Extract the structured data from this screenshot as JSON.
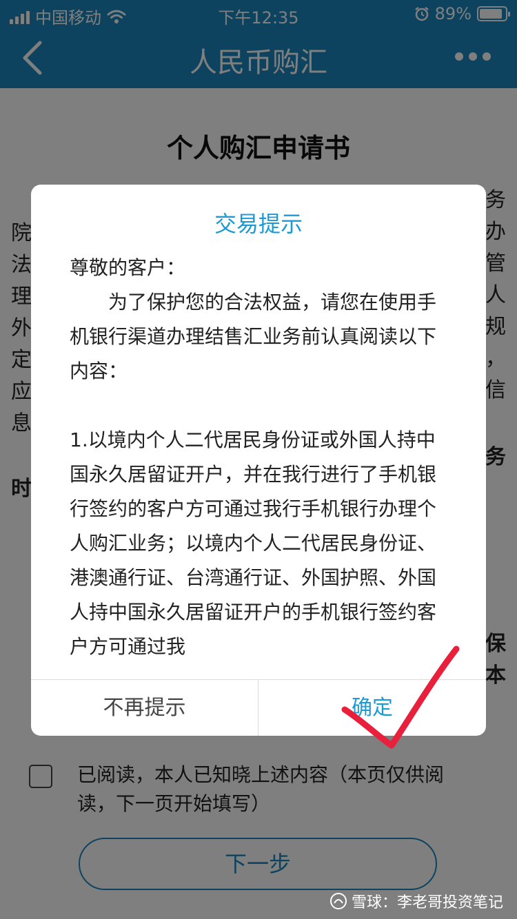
{
  "status_bar": {
    "carrier": "中国移动",
    "time": "下午12:35",
    "battery": "89%",
    "battery_level": 0.89
  },
  "nav": {
    "title": "人民币购汇",
    "back_icon": "chevron-left-icon",
    "more_icon": "more-dots-icon"
  },
  "page": {
    "doc_title": "个人购汇申请书",
    "left_edge": [
      "院",
      "法",
      "理",
      "外",
      "定",
      "应",
      "息"
    ],
    "right_edge": [
      "务",
      "办",
      "管",
      "人",
      "规",
      "，",
      "信"
    ],
    "bold_left": "时",
    "bold_right": "务",
    "bold_right_lower": [
      "保",
      "本"
    ],
    "read_confirm": "已阅读，本人已知晓上述内容（本页仅供阅读，下一页开始填写）",
    "next_button": "下一步"
  },
  "dialog": {
    "title": "交易提示",
    "greeting": "尊敬的客户：",
    "intro": "为了保护您的合法权益，请您在使用手机银行渠道办理结售汇业务前认真阅读以下内容：",
    "item1": "1.以境内个人二代居民身份证或外国人持中国永久居留证开户，并在我行进行了手机银行签约的客户方可通过我行手机银行办理个人购汇业务；以境内个人二代居民身份证、港澳通行证、台湾通行证、外国护照、外国人持中国永久居留证开户的手机银行签约客户方可通过我",
    "dismiss_button": "不再提示",
    "confirm_button": "确定"
  },
  "watermark": {
    "text": "雪球：李老哥投资笔记"
  },
  "colors": {
    "primary": "#1b86bd",
    "dialog_accent": "#1b9ad6",
    "annotation": "#e8203c"
  }
}
